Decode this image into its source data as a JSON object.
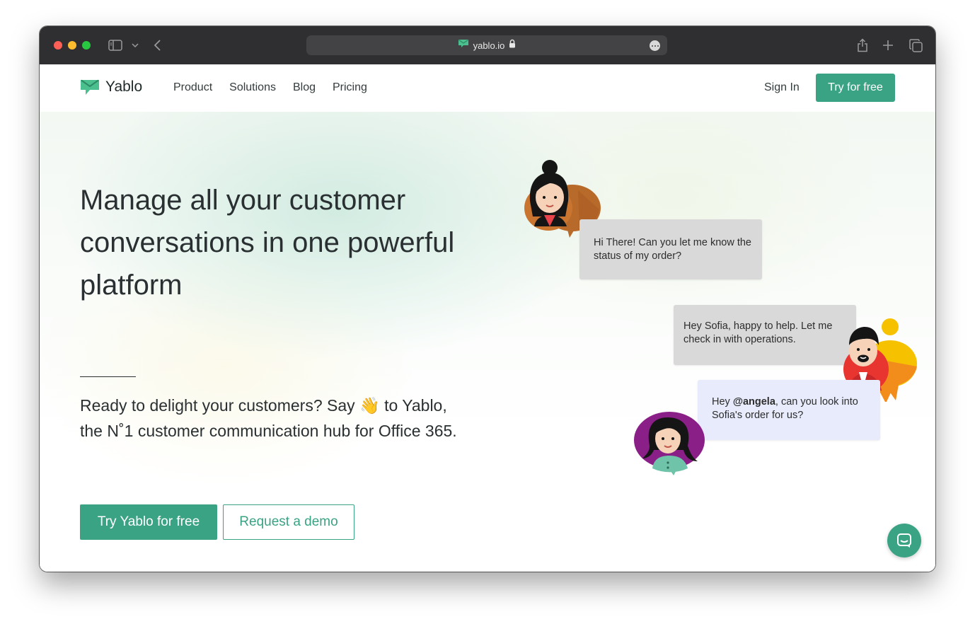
{
  "browser": {
    "url": "yablo.io"
  },
  "nav": {
    "brand": "Yablo",
    "links": [
      "Product",
      "Solutions",
      "Blog",
      "Pricing"
    ],
    "sign_in": "Sign In",
    "cta": "Try for free"
  },
  "hero": {
    "headline": "Manage all your customer conversations in one powerful platform",
    "subcopy_before": "Ready to delight your customers? Say",
    "wave_emoji": "👋",
    "subcopy_after": "to Yablo, the N˚1 customer communication hub for Office 365.",
    "primary_cta": "Try Yablo for free",
    "secondary_cta": "Request a demo"
  },
  "chat": {
    "message_1": "Hi There! Can you let me know the status of my order?",
    "message_2": "Hey Sofia, happy to help. Let me check in with operations.",
    "message_3_before": "Hey",
    "message_3_mention": "@angela",
    "message_3_after": ", can you look into Sofia's order for us?"
  },
  "colors": {
    "brand_green": "#3aa384",
    "chrome_dark": "#2f2f31",
    "text_dark": "#2a3032"
  }
}
